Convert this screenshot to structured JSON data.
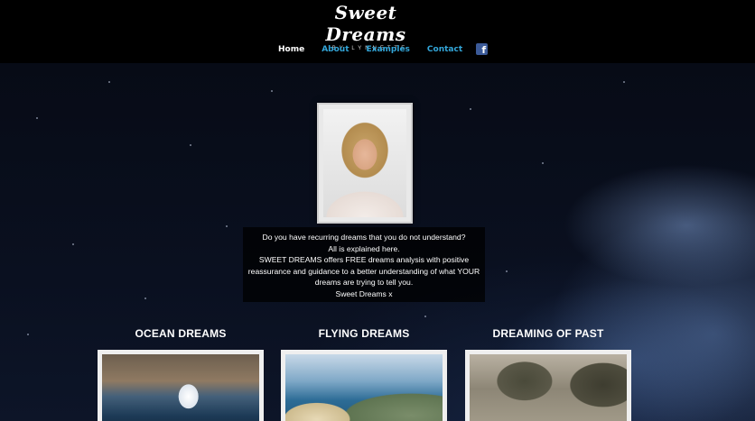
{
  "brand": {
    "title": "Sweet Dreams",
    "subtitle": "BY LYNNETTE"
  },
  "nav": {
    "items": [
      {
        "label": "Home",
        "active": true
      },
      {
        "label": "About",
        "active": false
      },
      {
        "label": "Examples",
        "active": false
      },
      {
        "label": "Contact",
        "active": false
      }
    ],
    "facebook_icon": "facebook-icon",
    "facebook_glyph": "f"
  },
  "intro": {
    "lines": [
      "Do you have recurring dreams that you do not understand?",
      "All is explained here.",
      "SWEET DREAMS offers FREE dreams analysis with positive",
      "reassurance and guidance to a better understanding of what YOUR",
      "dreams are trying to tell you.",
      "Sweet Dreams x"
    ]
  },
  "sections": [
    {
      "title": "OCEAN DREAMS"
    },
    {
      "title": "FLYING DREAMS"
    },
    {
      "title": "DREAMING OF PAST"
    }
  ],
  "colors": {
    "nav_link": "#33a6d9",
    "nav_active": "#ffffff",
    "header_bg": "#000000",
    "facebook": "#3b5a98"
  }
}
